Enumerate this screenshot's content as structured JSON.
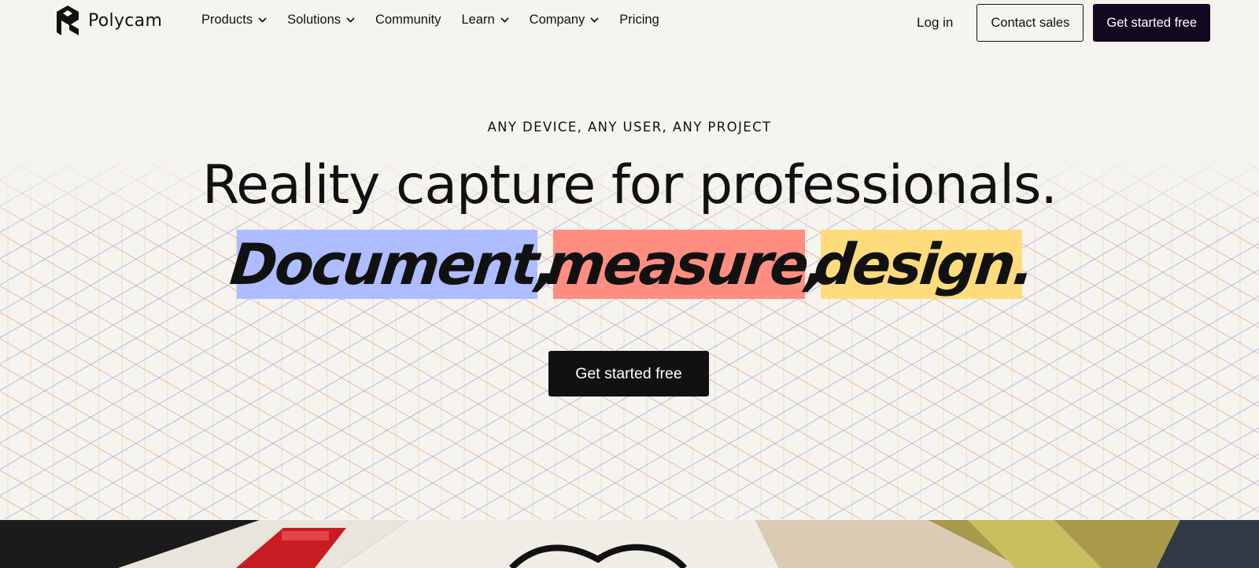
{
  "brand": {
    "name": "Polycam",
    "logo_icon": "polycam-logo-icon"
  },
  "nav": {
    "items": [
      {
        "label": "Products",
        "dropdown": true
      },
      {
        "label": "Solutions",
        "dropdown": true
      },
      {
        "label": "Community",
        "dropdown": false
      },
      {
        "label": "Learn",
        "dropdown": true
      },
      {
        "label": "Company",
        "dropdown": true
      },
      {
        "label": "Pricing",
        "dropdown": false
      }
    ],
    "login_label": "Log in",
    "contact_label": "Contact sales",
    "cta_label": "Get started free"
  },
  "hero": {
    "eyebrow": "ANY DEVICE, ANY USER, ANY PROJECT",
    "headline": "Reality capture for professionals.",
    "highlights": [
      {
        "text": "Document,",
        "color": "#aebdff"
      },
      {
        "text": "measure,",
        "color": "#ff8e80"
      },
      {
        "text": "design.",
        "color": "#fedc7e"
      }
    ],
    "cta_label": "Get started free"
  },
  "colors": {
    "background": "#f5f4ef",
    "dark_button": "#12081f",
    "grid_red": "#e6a3a3",
    "grid_blue": "#9ea8ec",
    "grid_gold": "#ecd2a0"
  }
}
